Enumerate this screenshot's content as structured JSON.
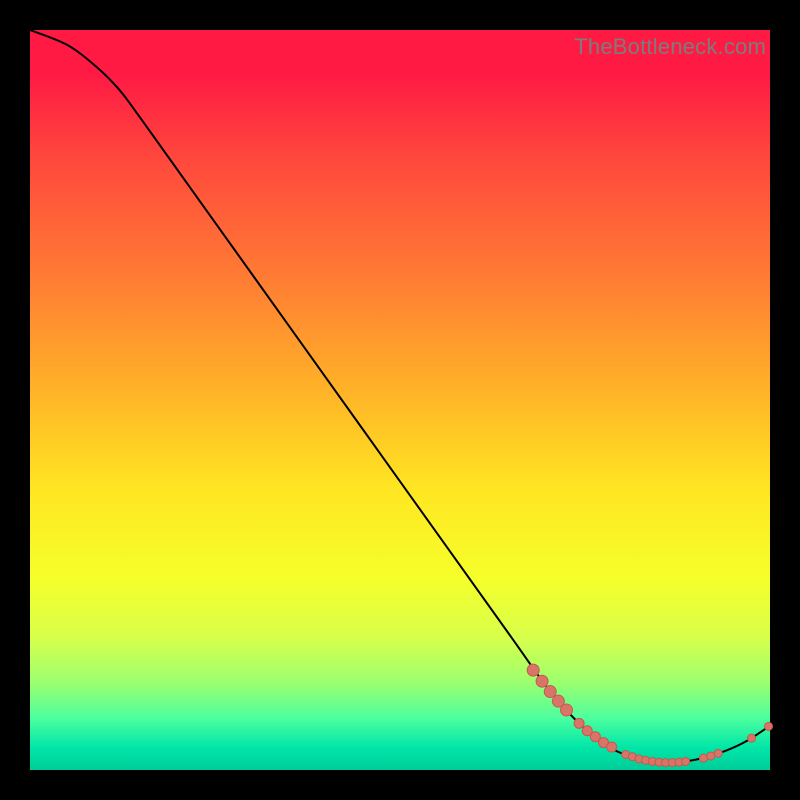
{
  "watermark": "TheBottleneck.com",
  "chart_data": {
    "type": "line",
    "title": "",
    "xlabel": "",
    "ylabel": "",
    "xlim": [
      0,
      100
    ],
    "ylim": [
      0,
      100
    ],
    "curve": [
      {
        "x": 0,
        "y": 100
      },
      {
        "x": 5,
        "y": 98
      },
      {
        "x": 9,
        "y": 95
      },
      {
        "x": 12,
        "y": 92
      },
      {
        "x": 15,
        "y": 88
      },
      {
        "x": 25,
        "y": 74
      },
      {
        "x": 40,
        "y": 53
      },
      {
        "x": 55,
        "y": 32
      },
      {
        "x": 65,
        "y": 18
      },
      {
        "x": 70,
        "y": 11
      },
      {
        "x": 74,
        "y": 6.5
      },
      {
        "x": 78,
        "y": 3.2
      },
      {
        "x": 82,
        "y": 1.6
      },
      {
        "x": 86,
        "y": 1.0
      },
      {
        "x": 90,
        "y": 1.4
      },
      {
        "x": 94,
        "y": 2.6
      },
      {
        "x": 97,
        "y": 4.0
      },
      {
        "x": 100,
        "y": 6.0
      }
    ],
    "markers": [
      {
        "x": 68.0,
        "y": 13.5,
        "r": 6
      },
      {
        "x": 69.2,
        "y": 12.0,
        "r": 6
      },
      {
        "x": 70.3,
        "y": 10.6,
        "r": 6
      },
      {
        "x": 71.4,
        "y": 9.3,
        "r": 6
      },
      {
        "x": 72.5,
        "y": 8.1,
        "r": 6
      },
      {
        "x": 74.2,
        "y": 6.3,
        "r": 5
      },
      {
        "x": 75.3,
        "y": 5.3,
        "r": 5
      },
      {
        "x": 76.4,
        "y": 4.5,
        "r": 5
      },
      {
        "x": 77.5,
        "y": 3.7,
        "r": 5
      },
      {
        "x": 78.6,
        "y": 3.1,
        "r": 5
      },
      {
        "x": 80.5,
        "y": 2.1,
        "r": 4
      },
      {
        "x": 81.4,
        "y": 1.8,
        "r": 4
      },
      {
        "x": 82.3,
        "y": 1.5,
        "r": 4
      },
      {
        "x": 83.2,
        "y": 1.3,
        "r": 4
      },
      {
        "x": 84.1,
        "y": 1.15,
        "r": 4
      },
      {
        "x": 85.0,
        "y": 1.05,
        "r": 4
      },
      {
        "x": 85.9,
        "y": 1.0,
        "r": 4
      },
      {
        "x": 86.8,
        "y": 1.0,
        "r": 4
      },
      {
        "x": 87.7,
        "y": 1.05,
        "r": 4
      },
      {
        "x": 88.6,
        "y": 1.15,
        "r": 4
      },
      {
        "x": 91.0,
        "y": 1.6,
        "r": 4
      },
      {
        "x": 92.0,
        "y": 1.9,
        "r": 4
      },
      {
        "x": 93.0,
        "y": 2.25,
        "r": 4
      },
      {
        "x": 97.5,
        "y": 4.3,
        "r": 4
      },
      {
        "x": 99.8,
        "y": 5.9,
        "r": 4
      }
    ]
  }
}
